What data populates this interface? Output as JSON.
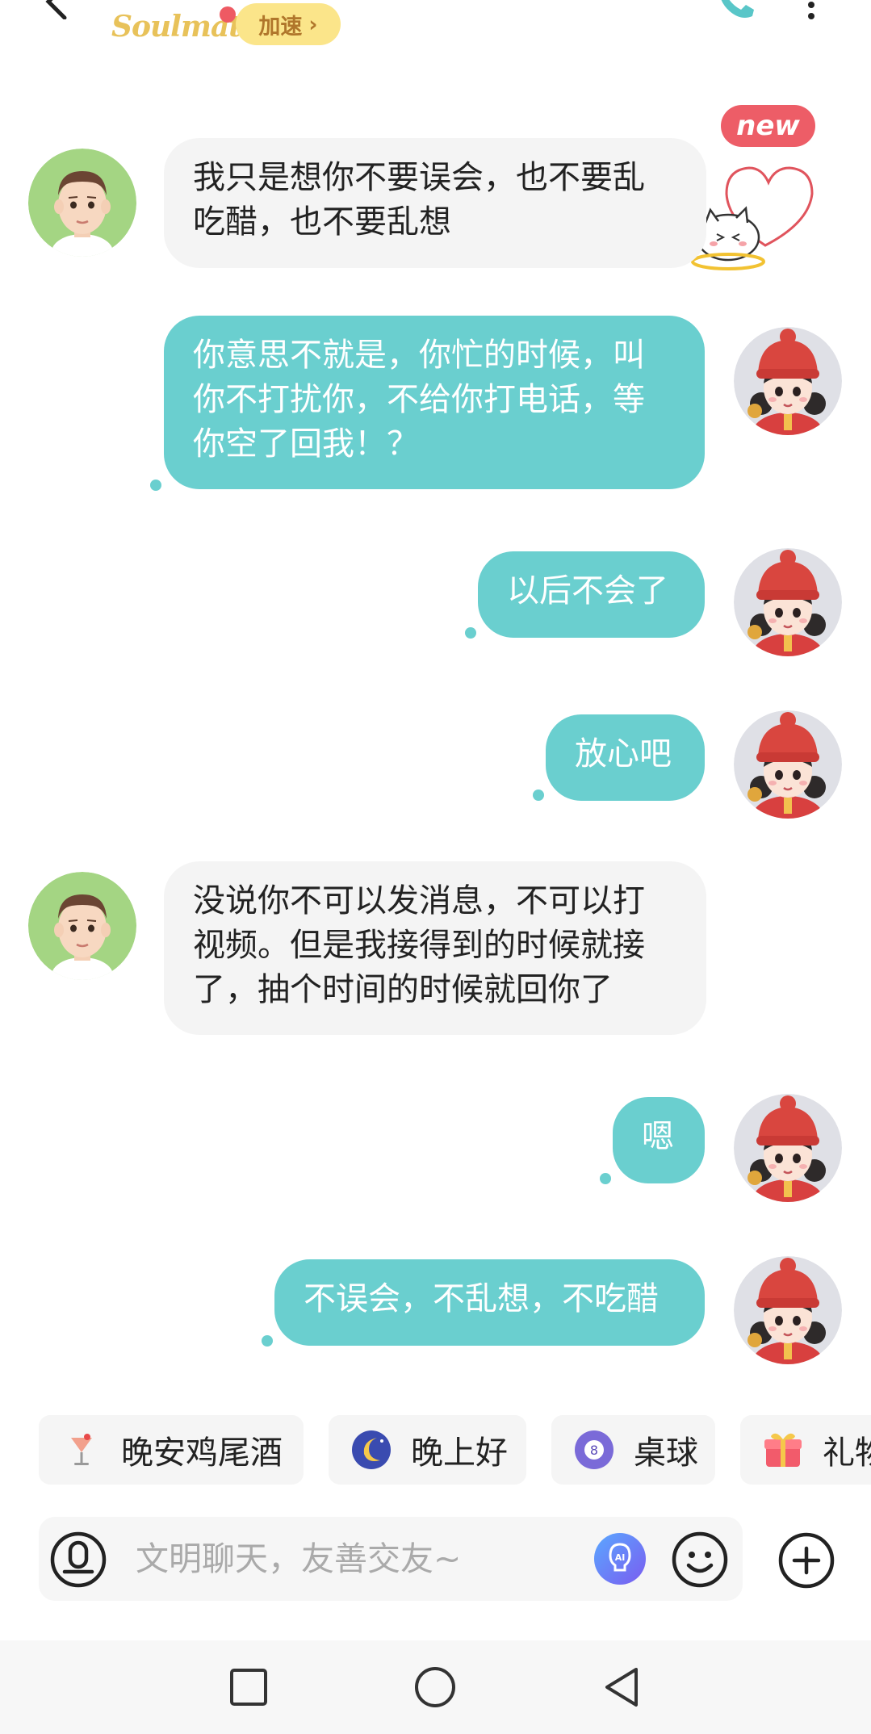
{
  "header": {
    "logo_text": "Soulmate",
    "speed_label": "加速",
    "speed_chevron": "›"
  },
  "sticker": {
    "badge": "new"
  },
  "messages": [
    {
      "side": "left",
      "lines": [
        "我只是想你不要误会，也不要乱",
        "吃醋，也不要乱想"
      ]
    },
    {
      "side": "right",
      "lines": [
        "你意思不就是，你忙的时候，叫",
        "你不打扰你，不给你打电话，等",
        "你空了回我！？"
      ]
    },
    {
      "side": "right",
      "lines": [
        "以后不会了"
      ]
    },
    {
      "side": "right",
      "lines": [
        "放心吧"
      ]
    },
    {
      "side": "left",
      "lines": [
        "没说你不可以发消息，不可以打",
        "视频。但是我接得到的时候就接",
        "了，抽个时间的时候就回你了"
      ]
    },
    {
      "side": "right",
      "lines": [
        "嗯"
      ]
    },
    {
      "side": "right",
      "lines": [
        "不误会，不乱想，不吃醋"
      ]
    }
  ],
  "quick_chips": [
    {
      "label": "晚安鸡尾酒",
      "icon": "cocktail-icon"
    },
    {
      "label": "晚上好",
      "icon": "moon-icon"
    },
    {
      "label": "桌球",
      "icon": "billiard-ball-icon"
    },
    {
      "label": "礼物",
      "icon": "gift-icon"
    }
  ],
  "input": {
    "placeholder": "文明聊天，友善交友~",
    "value": ""
  },
  "icons": {
    "back": "back-arrow-icon",
    "phone": "phone-icon",
    "more": "more-vertical-icon",
    "voice": "voice-icon",
    "ai": "ai-assistant-icon",
    "emoji": "emoji-icon",
    "plus": "plus-icon",
    "nav_recent": "recent-apps-icon",
    "nav_home": "home-icon",
    "nav_back": "nav-back-icon"
  },
  "colors": {
    "accent_bubble": "#6acfcf",
    "left_bubble": "#f4f4f4",
    "badge_red": "#ed5d67",
    "speed_badge": "#fbe58a",
    "logo_gold": "#e8c25a"
  }
}
